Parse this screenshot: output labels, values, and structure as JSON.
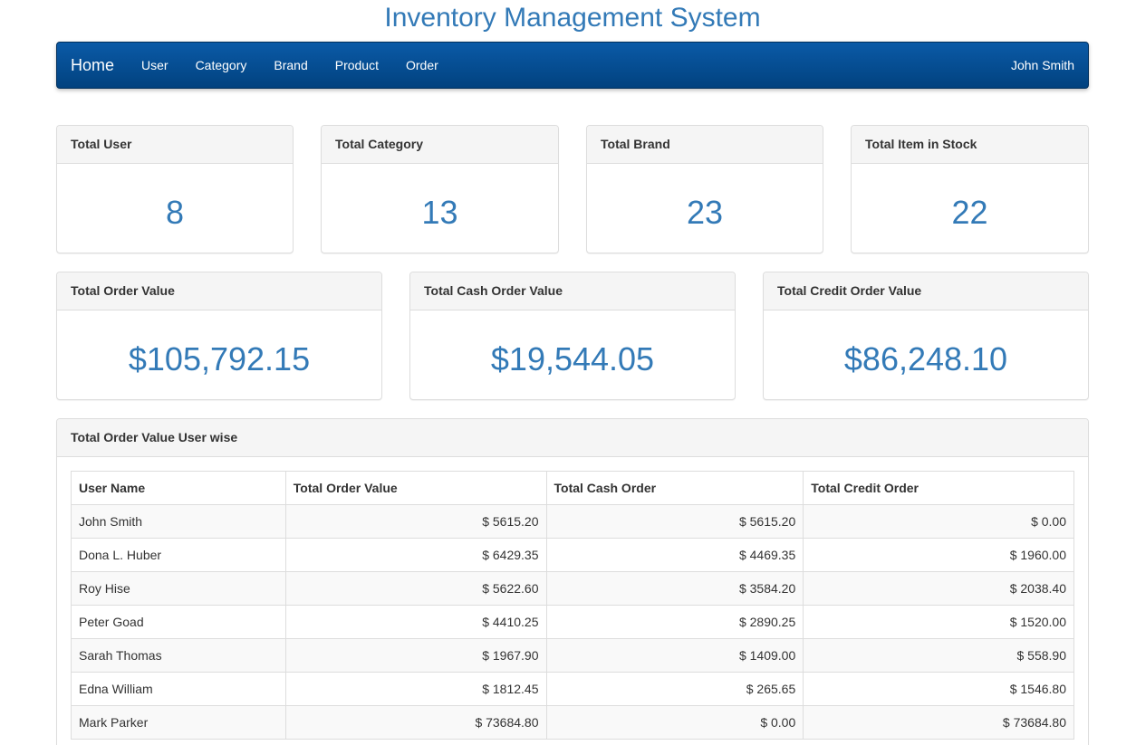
{
  "page": {
    "title": "Inventory Management System"
  },
  "navbar": {
    "brand": "Home",
    "items": [
      "User",
      "Category",
      "Brand",
      "Product",
      "Order"
    ],
    "user": "John Smith"
  },
  "stats": [
    {
      "label": "Total User",
      "value": "8"
    },
    {
      "label": "Total Category",
      "value": "13"
    },
    {
      "label": "Total Brand",
      "value": "23"
    },
    {
      "label": "Total Item in Stock",
      "value": "22"
    }
  ],
  "totals": [
    {
      "label": "Total Order Value",
      "value": "$105,792.15"
    },
    {
      "label": "Total Cash Order Value",
      "value": "$19,544.05"
    },
    {
      "label": "Total Credit Order Value",
      "value": "$86,248.10"
    }
  ],
  "userwise": {
    "title": "Total Order Value User wise",
    "columns": [
      "User Name",
      "Total Order Value",
      "Total Cash Order",
      "Total Credit Order"
    ],
    "rows": [
      [
        "John Smith",
        "$ 5615.20",
        "$ 5615.20",
        "$ 0.00"
      ],
      [
        "Dona L. Huber",
        "$ 6429.35",
        "$ 4469.35",
        "$ 1960.00"
      ],
      [
        "Roy Hise",
        "$ 5622.60",
        "$ 3584.20",
        "$ 2038.40"
      ],
      [
        "Peter Goad",
        "$ 4410.25",
        "$ 2890.25",
        "$ 1520.00"
      ],
      [
        "Sarah Thomas",
        "$ 1967.90",
        "$ 1409.00",
        "$ 558.90"
      ],
      [
        "Edna William",
        "$ 1812.45",
        "$ 265.65",
        "$ 1546.80"
      ],
      [
        "Mark Parker",
        "$ 73684.80",
        "$ 0.00",
        "$ 73684.80"
      ]
    ]
  },
  "colors": {
    "accent": "#337ab7",
    "navbar_top": "#0b5aa7",
    "navbar_bottom": "#01427f"
  }
}
